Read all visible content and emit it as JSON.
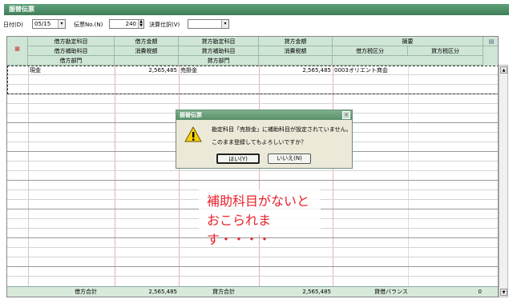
{
  "window": {
    "title": "振替伝票"
  },
  "toolbar": {
    "date_label": "日付(D)",
    "date_value": "05/15",
    "slip_label": "伝票No.(N)",
    "slip_value": "240",
    "settle_label": "決算仕訳(V)",
    "settle_value": ""
  },
  "header": {
    "debit_account": "借方勘定科目",
    "debit_amount": "借方金額",
    "credit_account": "貸方勘定科目",
    "credit_amount": "貸方金額",
    "summary": "摘要",
    "debit_sub": "借方補助科目",
    "tax": "消費税額",
    "credit_sub": "貸方補助科目",
    "tax2": "消費税額",
    "debit_tax_class": "借方税区分",
    "credit_tax_class": "貸方税区分",
    "debit_dept": "借方部門",
    "credit_dept": "貸方部門"
  },
  "row1": {
    "debit_account": "現金",
    "debit_amount": "2,565,485",
    "credit_account": "売掛金",
    "credit_amount": "2,565,485",
    "summary": "0003オリエント商会"
  },
  "footer": {
    "debit_total_label": "借方合計",
    "debit_total": "2,565,485",
    "credit_total_label": "貸方合計",
    "credit_total": "2,565,485",
    "balance_label": "貸借バランス",
    "balance": "0"
  },
  "dialog": {
    "title": "振替伝票",
    "message1": "勘定科目「売掛金」に補助科目が設定されていません。",
    "message2": "このまま登録してもよろしいですか？",
    "yes": "はい(Y)",
    "no": "いいえ(N)"
  },
  "callout": {
    "line1": "補助科目がないと",
    "line2": "おこられます・・・・"
  },
  "colors": {
    "title_green": "#3f7e58",
    "header_bg": "#cfe6d6",
    "callout_red": "#e8212b"
  }
}
